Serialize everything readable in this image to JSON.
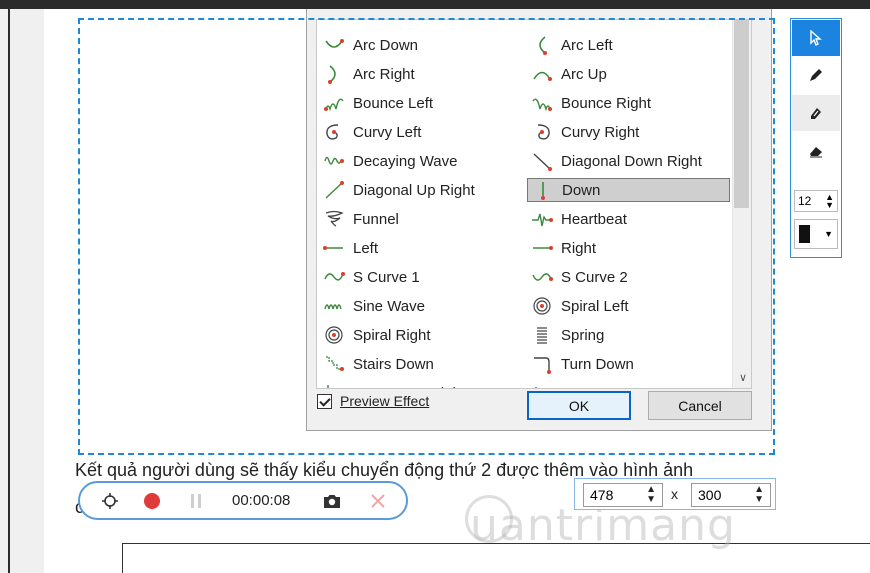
{
  "document": {
    "line1": "Kết quả người dùng sẽ thấy kiểu chuyển động thứ 2 được thêm vào hình ảnh",
    "line2": "c"
  },
  "watermark": "uantrimang",
  "dialog": {
    "items": [
      {
        "label": "Arc Down",
        "icon": "arc-down-icon"
      },
      {
        "label": "Arc Left",
        "icon": "arc-left-icon"
      },
      {
        "label": "Arc Right",
        "icon": "arc-right-icon"
      },
      {
        "label": "Arc Up",
        "icon": "arc-up-icon"
      },
      {
        "label": "Bounce Left",
        "icon": "bounce-left-icon"
      },
      {
        "label": "Bounce Right",
        "icon": "bounce-right-icon"
      },
      {
        "label": "Curvy Left",
        "icon": "curvy-left-icon"
      },
      {
        "label": "Curvy Right",
        "icon": "curvy-right-icon"
      },
      {
        "label": "Decaying Wave",
        "icon": "decaying-wave-icon"
      },
      {
        "label": "Diagonal Down Right",
        "icon": "diagonal-down-right-icon"
      },
      {
        "label": "Diagonal Up Right",
        "icon": "diagonal-up-right-icon"
      },
      {
        "label": "Down",
        "icon": "down-icon"
      },
      {
        "label": "Funnel",
        "icon": "funnel-icon"
      },
      {
        "label": "Heartbeat",
        "icon": "heartbeat-icon"
      },
      {
        "label": "Left",
        "icon": "left-icon"
      },
      {
        "label": "Right",
        "icon": "right-icon"
      },
      {
        "label": "S Curve 1",
        "icon": "s-curve-1-icon"
      },
      {
        "label": "S Curve 2",
        "icon": "s-curve-2-icon"
      },
      {
        "label": "Sine Wave",
        "icon": "sine-wave-icon"
      },
      {
        "label": "Spiral Left",
        "icon": "spiral-left-icon"
      },
      {
        "label": "Spiral Right",
        "icon": "spiral-right-icon"
      },
      {
        "label": "Spring",
        "icon": "spring-icon"
      },
      {
        "label": "Stairs Down",
        "icon": "stairs-down-icon"
      },
      {
        "label": "Turn Down",
        "icon": "turn-down-icon"
      },
      {
        "label": "Turn Down Right",
        "icon": "turn-down-right-icon"
      },
      {
        "label": "Turn Up",
        "icon": "turn-up-icon"
      }
    ],
    "selected": "Down",
    "preview_label": "Preview Effect",
    "preview_checked": true,
    "ok_label": "OK",
    "cancel_label": "Cancel"
  },
  "toolpanel": {
    "tools": [
      "select-icon",
      "pen-icon",
      "highlighter-icon",
      "eraser-icon"
    ],
    "active_tool": "select-icon",
    "pen_size": "12",
    "pen_color": "#111111"
  },
  "recorder": {
    "time": "00:00:08"
  },
  "sizebox": {
    "width": "478",
    "height": "300",
    "separator": "x"
  },
  "colors": {
    "accent": "#1a84e0",
    "record": "#e03a3a",
    "selection": "#1e8ad6",
    "icon_red": "#d9402f",
    "icon_green": "#3b8a3b"
  }
}
